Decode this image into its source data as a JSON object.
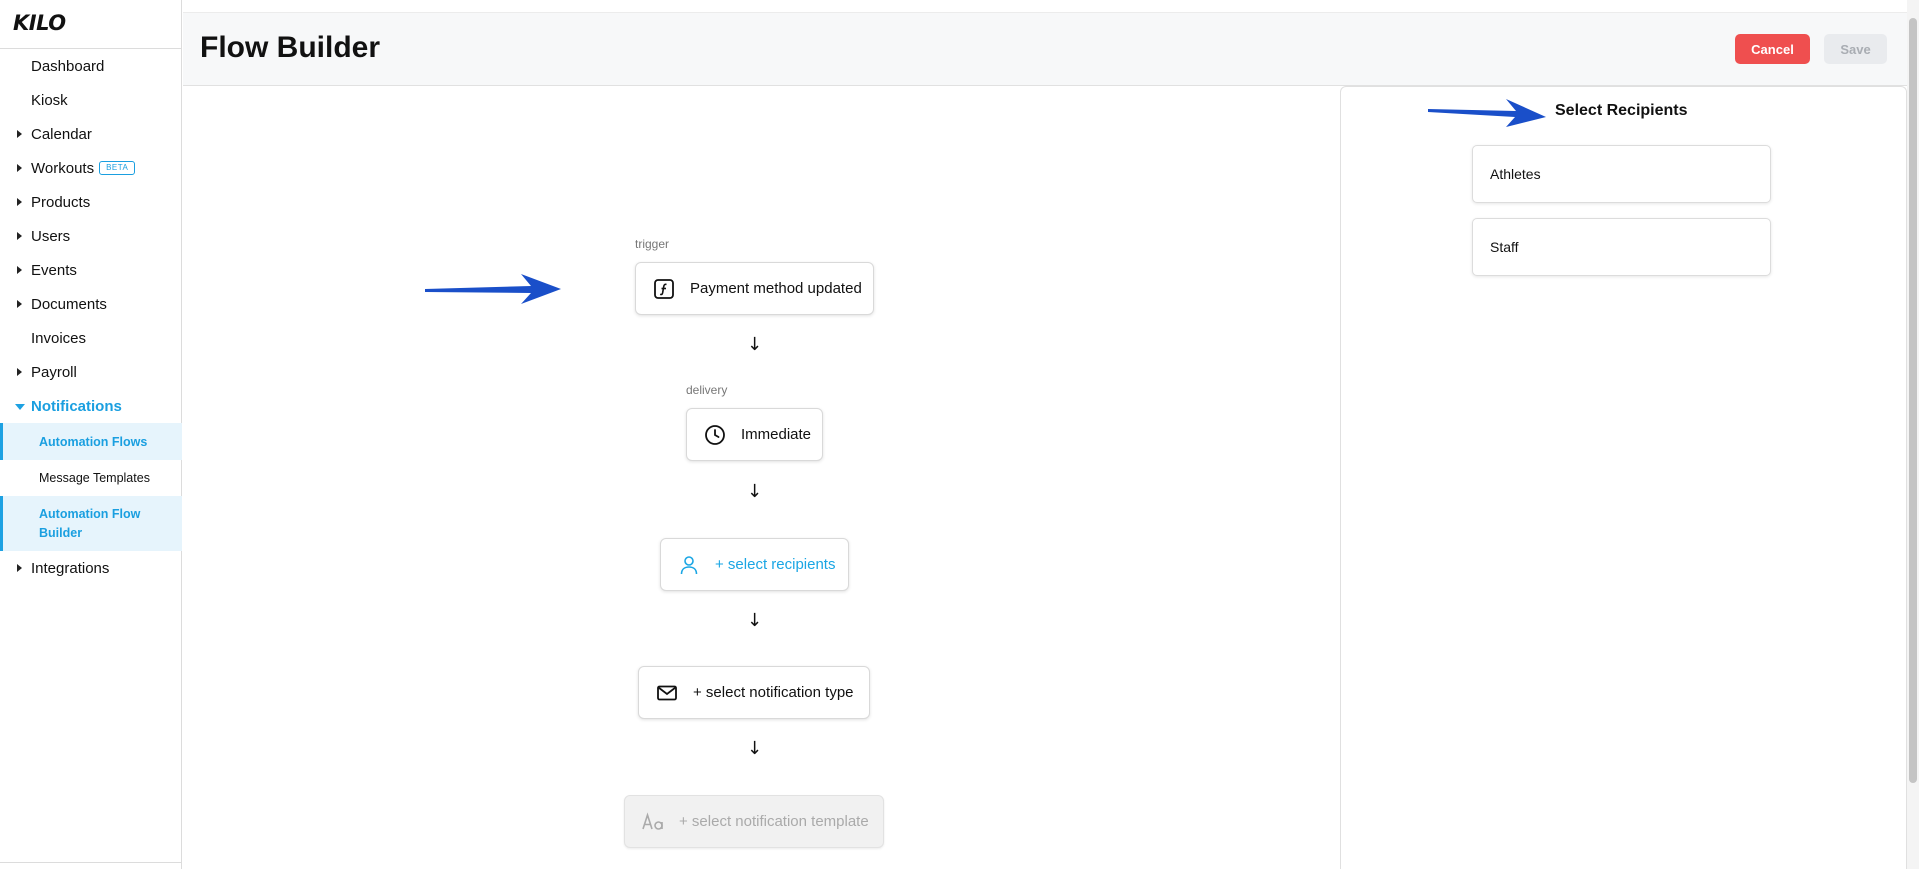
{
  "sidebar": {
    "logo": "KILO",
    "items": [
      {
        "label": "Dashboard"
      },
      {
        "label": "Kiosk"
      },
      {
        "label": "Calendar"
      },
      {
        "label": "Workouts",
        "badge": "BETA"
      },
      {
        "label": "Products"
      },
      {
        "label": "Users"
      },
      {
        "label": "Events"
      },
      {
        "label": "Documents"
      },
      {
        "label": "Invoices"
      },
      {
        "label": "Payroll"
      },
      {
        "label": "Notifications"
      },
      {
        "label": "Integrations"
      }
    ],
    "sub_items": [
      {
        "label": "Automation Flows"
      },
      {
        "label": "Message Templates"
      },
      {
        "label": "Automation Flow Builder"
      }
    ]
  },
  "header": {
    "title": "Flow Builder",
    "cancel_label": "Cancel",
    "save_label": "Save"
  },
  "flow": {
    "trigger_label": "trigger",
    "trigger_value": "Payment method updated",
    "delivery_label": "delivery",
    "delivery_value": "Immediate",
    "recipients_value": "+ select recipients",
    "notification_type_value": "+ select notification type",
    "notification_template_value": "+ select notification template",
    "arrow_glyph": "↓"
  },
  "panel": {
    "title": "Select Recipients",
    "options": [
      {
        "label": "Athletes"
      },
      {
        "label": "Staff"
      }
    ]
  },
  "colors": {
    "accent": "#1da1e2",
    "cancel": "#ef4f4f",
    "annotation_arrow": "#1a4fc9"
  },
  "icons": {
    "trigger": "function-icon",
    "delivery": "clock-icon",
    "recipients": "user-icon",
    "notification_type": "mail-icon",
    "notification_template": "typography-icon"
  }
}
